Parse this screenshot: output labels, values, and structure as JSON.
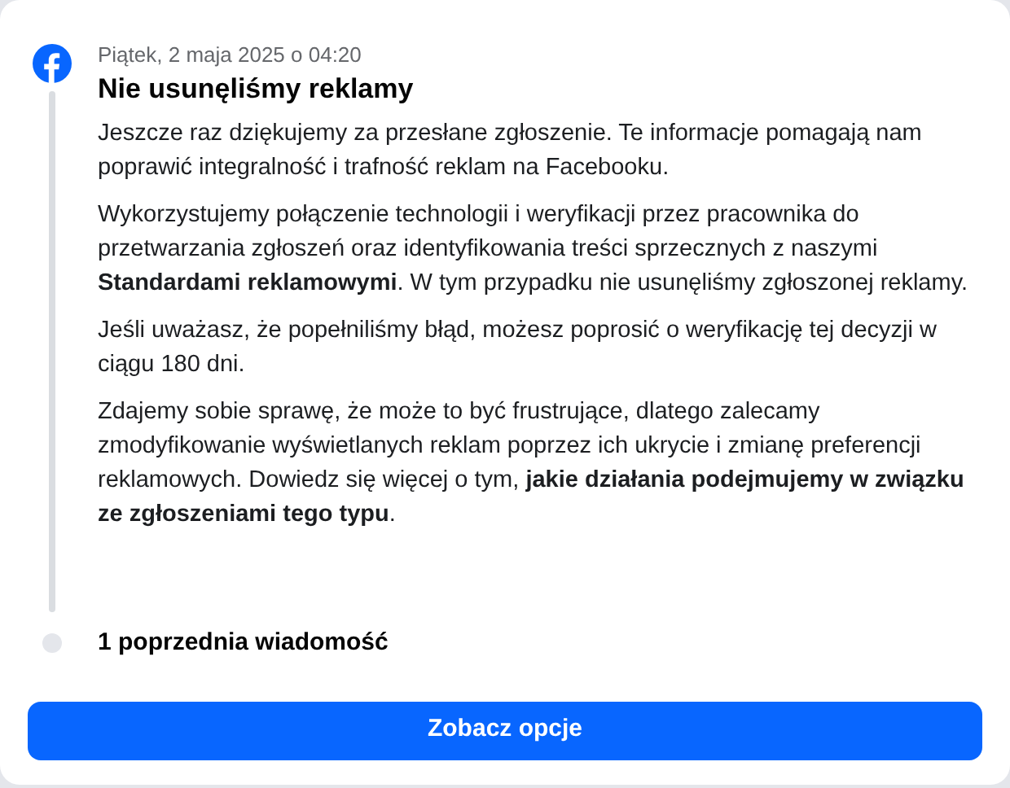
{
  "message": {
    "date": "Piątek, 2 maja 2025 o 04:20",
    "title": "Nie usunęliśmy reklamy",
    "paragraphs": [
      "Jeszcze raz dziękujemy za przesłane zgłoszenie. Te informacje pomagają nam poprawić integralność i trafność reklam na Facebooku.",
      "Wykorzystujemy połączenie technologii i weryfikacji przez pracownika do przetwarzania zgłoszeń oraz identyfikowania treści sprzecznych z naszymi **Standardami reklamowymi**. W tym przypadku nie usunęliśmy zgłoszonej reklamy.",
      "Jeśli uważasz, że popełniliśmy błąd, możesz poprosić o weryfikację tej decyzji w ciągu 180 dni.",
      "Zdajemy sobie sprawę, że może to być frustrujące, dlatego zalecamy zmodyfikowanie wyświetlanych reklam poprzez ich ukrycie i zmianę preferencji reklamowych. Dowiedz się więcej o tym, **jakie działania podejmujemy w związku ze zgłoszeniami tego typu**."
    ]
  },
  "previous": {
    "label": "1 poprzednia wiadomość"
  },
  "button": {
    "label": "Zobacz opcje"
  }
}
